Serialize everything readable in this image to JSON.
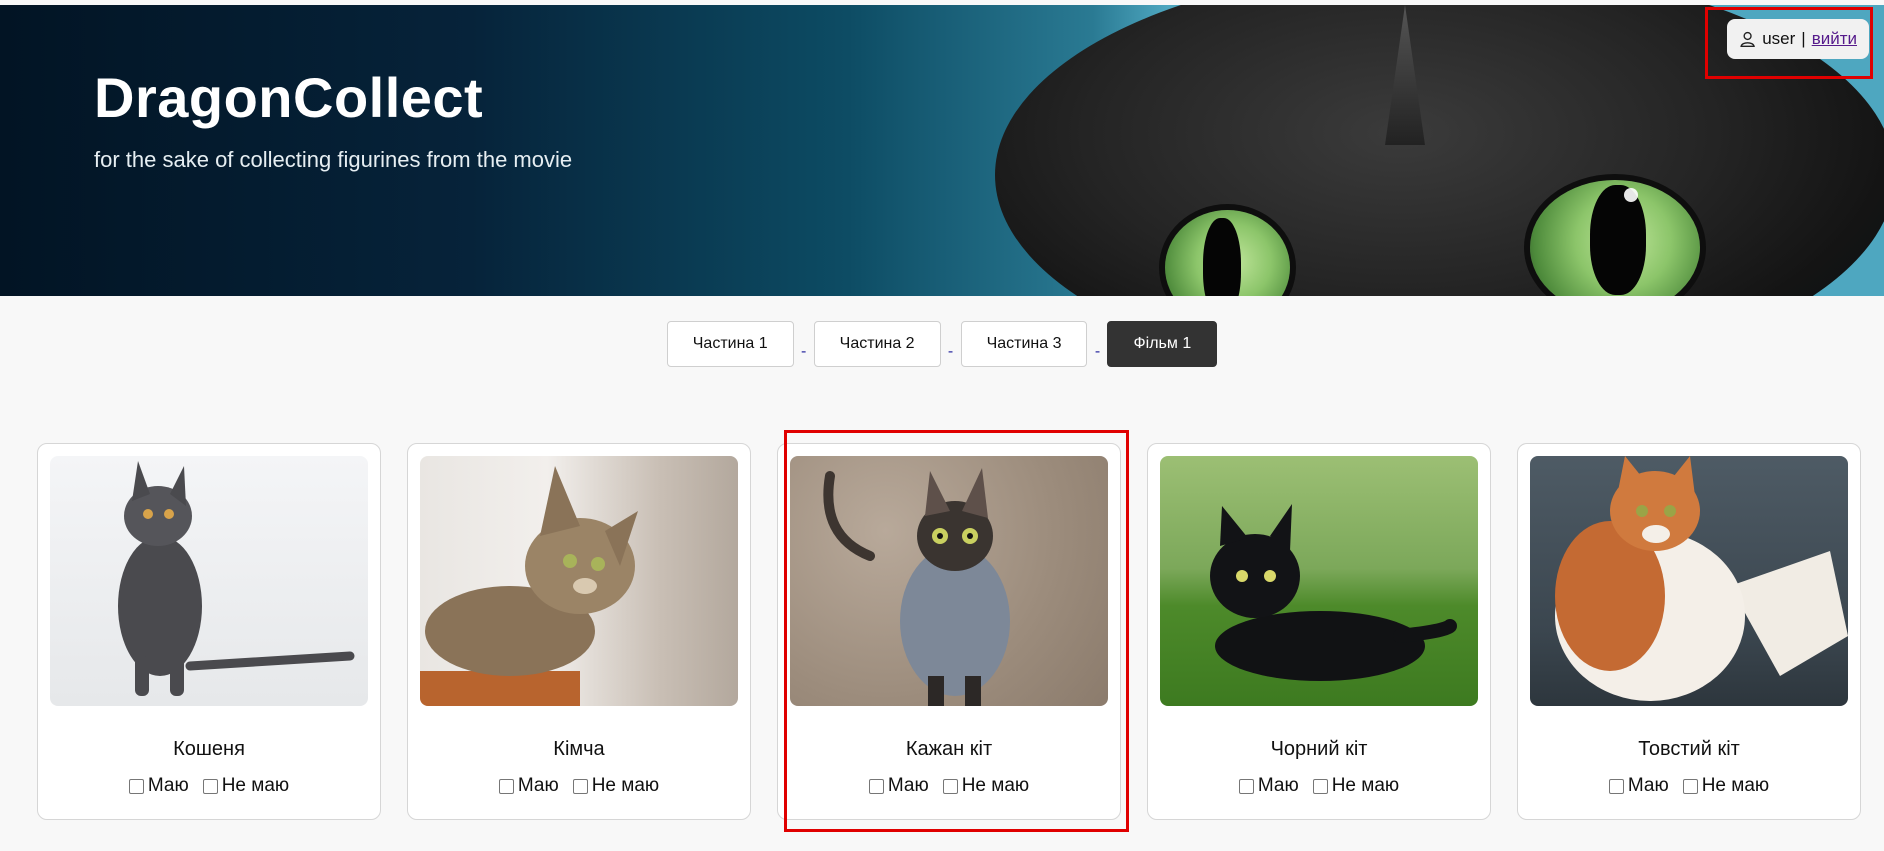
{
  "header": {
    "title": "DragonCollect",
    "subtitle": "for the sake of collecting figurines from the movie",
    "user": {
      "name": "user",
      "separator": "|",
      "logout_label": "вийти",
      "icon": "user-icon"
    }
  },
  "tabs": [
    {
      "label": "Частина 1",
      "active": false
    },
    {
      "label": "Частина 2",
      "active": false
    },
    {
      "label": "Частина 3",
      "active": false
    },
    {
      "label": "Фільм 1",
      "active": true
    }
  ],
  "tab_separator": "-",
  "cards": [
    {
      "name": "Кошеня",
      "have_label": "Маю",
      "not_have_label": "Не маю",
      "have": false,
      "not_have": false
    },
    {
      "name": "Кімча",
      "have_label": "Маю",
      "not_have_label": "Не маю",
      "have": false,
      "not_have": false
    },
    {
      "name": "Кажан кіт",
      "have_label": "Маю",
      "not_have_label": "Не маю",
      "have": false,
      "not_have": false
    },
    {
      "name": "Чорний кіт",
      "have_label": "Маю",
      "not_have_label": "Не маю",
      "have": false,
      "not_have": false
    },
    {
      "name": "Товстий кіт",
      "have_label": "Маю",
      "not_have_label": "Не маю",
      "have": false,
      "not_have": false
    }
  ],
  "colors": {
    "active_tab": "#333333",
    "highlight": "#e00000",
    "hero_dark": "#021424"
  }
}
